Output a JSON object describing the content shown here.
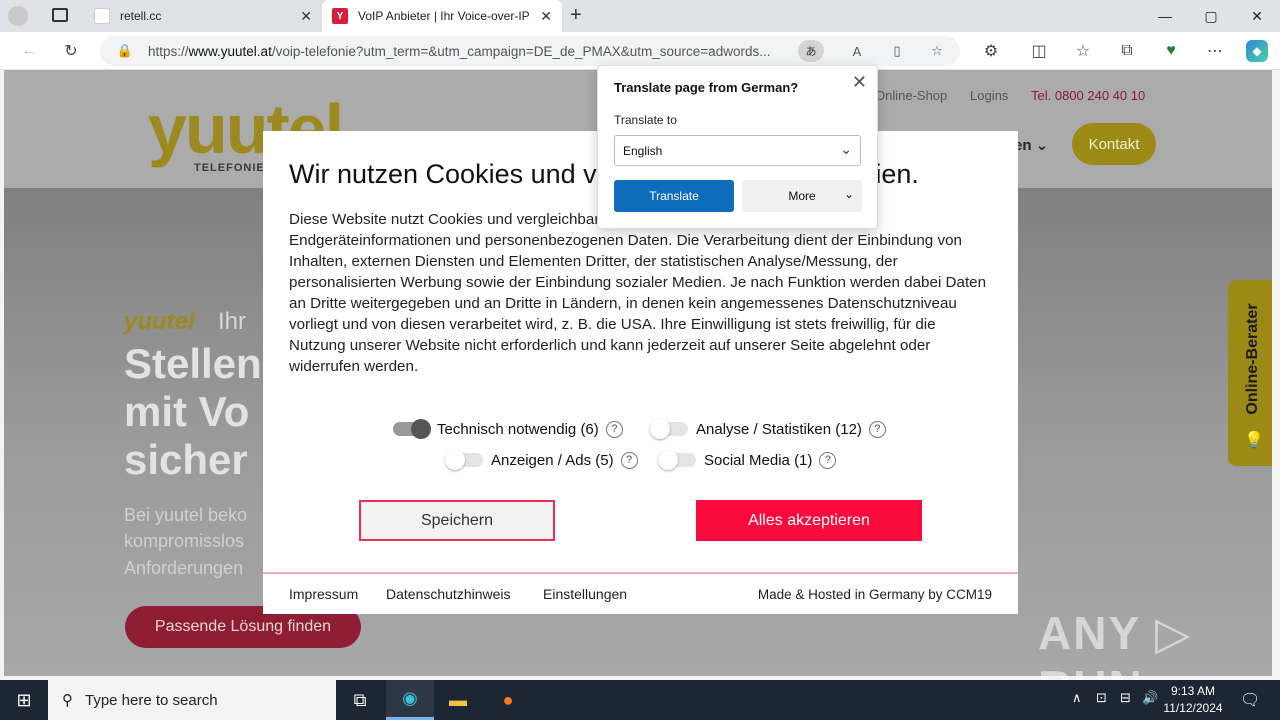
{
  "browser": {
    "tabs": [
      {
        "title": "retell.cc",
        "active": false
      },
      {
        "title": "VoIP Anbieter | Ihr Voice-over-IP",
        "active": true
      }
    ],
    "new_tab": "+",
    "url_prefix": "https://",
    "url_host": "www.yuutel.at",
    "url_rest": "/voip-telefonie?utm_term=&utm_campaign=DE_de_PMAX&utm_source=adwords...",
    "translate_icon": "あ",
    "window_controls": [
      "—",
      "▢",
      "✕"
    ]
  },
  "site": {
    "logo": "yuutel",
    "logo_sub": "TELEFONIE I",
    "top_links": [
      "Online-Shop",
      "Logins",
      "Tel. 0800 240 40 10"
    ],
    "nav_partial": "en",
    "kontakt": "Kontakt",
    "hero_brand": "yuutel",
    "hero_brand_rest": "Ihr",
    "hero_lines": [
      "Stellen",
      "mit Vo",
      "sicher"
    ],
    "hero_para": [
      "Bei yuutel beko",
      "kompromisslos",
      "Anforderungen"
    ],
    "hero_cta": "Passende Lösung finden",
    "berater": "Online-Berater"
  },
  "cookie": {
    "title": "Wir nutzen Cookies und vergleichbare Technologien.",
    "body": "Diese Website nutzt Cookies und vergleichbare Funktionen zur Verarbeitung von Endgeräteinformationen und personenbezogenen Daten. Die Verarbeitung dient der Einbindung von Inhalten, externen Diensten und Elementen Dritter, der statistischen Analyse/Messung, der personalisierten Werbung sowie der Einbindung sozialer Medien. Je nach Funktion werden dabei Daten an Dritte weitergegeben und an Dritte in Ländern, in denen kein angemessenes Datenschutzniveau vorliegt und von diesen verarbeitet wird, z. B. die USA. Ihre Einwilligung ist stets freiwillig, für die Nutzung unserer Website nicht erforderlich und kann jederzeit auf unserer Seite abgelehnt oder widerrufen werden.",
    "options": [
      {
        "label": "Technisch notwendig",
        "count": "(6)",
        "on": true
      },
      {
        "label": "Analyse / Statistiken",
        "count": "(12)",
        "on": false
      },
      {
        "label": "Anzeigen / Ads",
        "count": "(5)",
        "on": false
      },
      {
        "label": "Social Media",
        "count": "(1)",
        "on": false
      }
    ],
    "help": "?",
    "save": "Speichern",
    "accept": "Alles akzeptieren",
    "footer_links": [
      "Impressum",
      "Datenschutzhinweis",
      "Einstellungen"
    ],
    "made": "Made & Hosted in Germany by CCM19"
  },
  "translate": {
    "title": "Translate page from German?",
    "label": "Translate to",
    "selected": "English",
    "translate_btn": "Translate",
    "more_btn": "More"
  },
  "watermark": "ANY ▷ RUN",
  "taskbar": {
    "search_placeholder": "Type here to search",
    "time": "9:13 AM",
    "date": "11/12/2024"
  }
}
